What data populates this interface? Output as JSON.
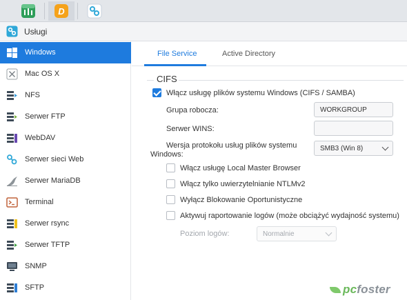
{
  "taskbar": {
    "apps": [
      {
        "icon": "equalizer-app-icon",
        "color": "#2e9e5a"
      },
      {
        "icon": "d-app-icon",
        "color": "#f5a21b",
        "letter": "D"
      },
      {
        "icon": "services-app-icon",
        "color": "#2fa8d8"
      }
    ]
  },
  "window": {
    "title": "Usługi"
  },
  "sidebar": {
    "items": [
      {
        "label": "Windows",
        "icon": "windows-icon",
        "active": true
      },
      {
        "label": "Mac OS X",
        "icon": "mac-os-icon"
      },
      {
        "label": "NFS",
        "icon": "nfs-icon"
      },
      {
        "label": "Serwer FTP",
        "icon": "ftp-icon"
      },
      {
        "label": "WebDAV",
        "icon": "webdav-icon"
      },
      {
        "label": "Serwer sieci Web",
        "icon": "web-server-icon"
      },
      {
        "label": "Serwer MariaDB",
        "icon": "mariadb-icon"
      },
      {
        "label": "Terminal",
        "icon": "terminal-icon"
      },
      {
        "label": "Serwer rsync",
        "icon": "rsync-icon"
      },
      {
        "label": "Serwer TFTP",
        "icon": "tftp-icon"
      },
      {
        "label": "SNMP",
        "icon": "snmp-icon"
      },
      {
        "label": "SFTP",
        "icon": "sftp-icon"
      }
    ]
  },
  "tabs": [
    {
      "label": "File Service",
      "active": true
    },
    {
      "label": "Active Directory"
    }
  ],
  "cifs": {
    "section_title": "CIFS",
    "enable_label": "Włącz usługę plików systemu Windows (CIFS / SAMBA)",
    "enable_checked": true,
    "workgroup_label": "Grupa robocza:",
    "workgroup_value": "WORKGROUP",
    "wins_label": "Serwer WINS:",
    "wins_value": "",
    "protocol_label_1": "Wersja protokołu usług plików systemu",
    "protocol_label_2": "Windows:",
    "protocol_value": "SMB3 (Win 8)",
    "options": [
      {
        "label": "Włącz usługę Local Master Browser",
        "checked": false
      },
      {
        "label": "Włącz tylko uwierzytelnianie NTLMv2",
        "checked": false
      },
      {
        "label": "Wyłącz Blokowanie Oportunistyczne",
        "checked": false
      },
      {
        "label": "Aktywuj raportowanie logów (może obciążyć wydajność systemu)",
        "checked": false
      }
    ],
    "log_level_label": "Poziom logów:",
    "log_level_value": "Normalnie"
  },
  "watermark": {
    "prefix": "pc",
    "suffix": "foster"
  },
  "colors": {
    "accent": "#1e7bde",
    "sidebar_active": "#1e7bde"
  }
}
